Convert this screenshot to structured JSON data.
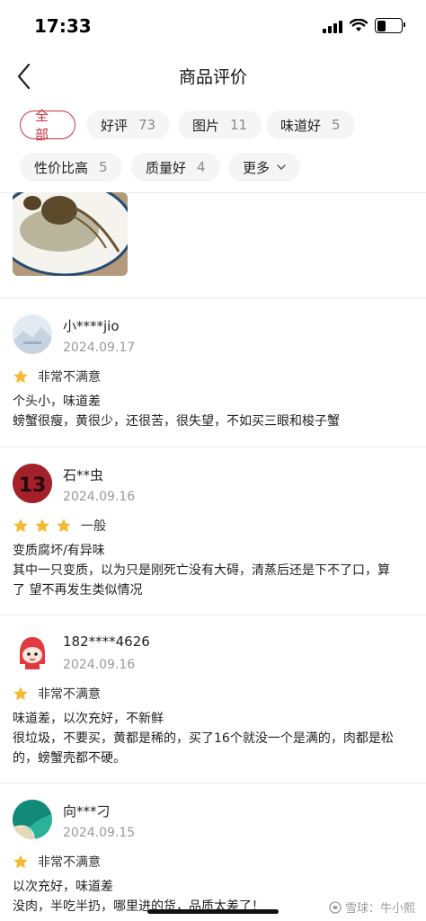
{
  "status": {
    "time": "17:33"
  },
  "nav": {
    "title": "商品评价"
  },
  "filters": [
    {
      "label": "全部",
      "count": "",
      "active": true
    },
    {
      "label": "好评",
      "count": "73"
    },
    {
      "label": "图片",
      "count": "11"
    },
    {
      "label": "味道好",
      "count": "5"
    },
    {
      "label": "性价比高",
      "count": "5"
    },
    {
      "label": "质量好",
      "count": "4"
    },
    {
      "label": "更多",
      "count": ""
    }
  ],
  "reviews": [
    {
      "user": "小****jio",
      "date": "2024.09.17",
      "rating": 1,
      "rating_text": "非常不满意",
      "lines": [
        "个头小，味道差",
        "螃蟹很瘦，黄很少，还很苦，很失望，不如买三眼和梭子蟹"
      ]
    },
    {
      "user": "石**虫",
      "date": "2024.09.16",
      "rating": 3,
      "rating_text": "一般",
      "lines": [
        "变质腐坏/有异味",
        "其中一只变质，以为只是刚死亡没有大碍，清蒸后还是下不了口，算",
        "了 望不再发生类似情况"
      ]
    },
    {
      "user": "182****4626",
      "date": "2024.09.16",
      "rating": 1,
      "rating_text": "非常不满意",
      "lines": [
        "味道差，以次充好，不新鲜",
        "很垃圾，不要买，黄都是稀的，买了16个就没一个是满的，肉都是松",
        "的，螃蟹壳都不硬。"
      ]
    },
    {
      "user": "向***刁",
      "date": "2024.09.15",
      "rating": 1,
      "rating_text": "非常不满意",
      "lines": [
        "以次充好，味道差",
        "没肉，半吃半扔，哪里进的货，品质太差了！"
      ]
    }
  ],
  "watermark": "雪球：牛小熙",
  "colors": {
    "accent": "#c9313d",
    "star": "#f5b82e"
  }
}
